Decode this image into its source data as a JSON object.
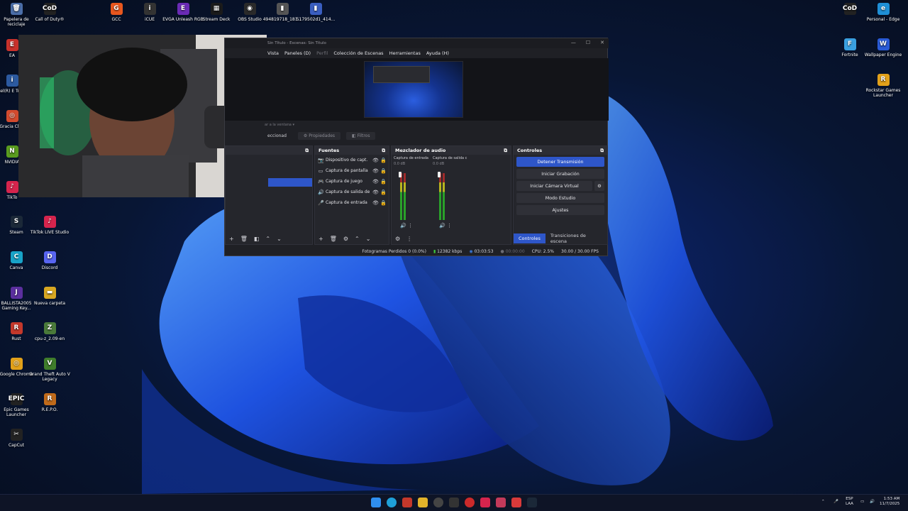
{
  "desktop_left": [
    {
      "label": "Papelera de reciclaje",
      "glyph": "🗑",
      "color": "#4b6ea8"
    },
    {
      "label": "Call of Duty®",
      "glyph": "CoD",
      "color": "#222"
    },
    {
      "label": "GCC",
      "glyph": "G",
      "color": "#e8571e"
    },
    {
      "label": "iCUE",
      "glyph": "i",
      "color": "#333"
    },
    {
      "label": "EVGA Unleash RGB",
      "glyph": "E",
      "color": "#6a2bb5"
    },
    {
      "label": "Stream Deck",
      "glyph": "▦",
      "color": "#1b1b1b"
    },
    {
      "label": "OBS Studio",
      "glyph": "◉",
      "color": "#2a2a2a"
    },
    {
      "label": "494819718_181...",
      "glyph": "▮",
      "color": "#555"
    },
    {
      "label": "5179502d1_414...",
      "glyph": "▮",
      "color": "#3a5ec0"
    }
  ],
  "desktop_col1": [
    {
      "label": "Steam",
      "glyph": "S",
      "color": "#1b2838"
    },
    {
      "label": "Canva",
      "glyph": "C",
      "color": "#18a3c8"
    },
    {
      "label": "BALLISTA2005 Gaming Key...",
      "glyph": "J",
      "color": "#5b2f9e"
    },
    {
      "label": "Rust",
      "glyph": "R",
      "color": "#c4382b"
    },
    {
      "label": "Google Chrome",
      "glyph": "◎",
      "color": "#e2a11a"
    },
    {
      "label": "Epic Games Launcher",
      "glyph": "EPIC",
      "color": "#222"
    },
    {
      "label": "CapCut",
      "glyph": "✂",
      "color": "#222"
    }
  ],
  "desktop_col1_partial": [
    {
      "label": "EA",
      "glyph": "E",
      "color": "#c8312b"
    },
    {
      "label": "Intel(R) E Tuning",
      "glyph": "i",
      "color": "#2c5aa0"
    },
    {
      "label": "Gracia Chro",
      "glyph": "◎",
      "color": "#d24a2e"
    },
    {
      "label": "NVIDIA",
      "glyph": "N",
      "color": "#5a9c1f"
    },
    {
      "label": "TikTo",
      "glyph": "♪",
      "color": "#d6244d"
    }
  ],
  "desktop_col2": [
    {
      "label": "TikTok LIVE Studio",
      "glyph": "♪",
      "color": "#d6244d"
    },
    {
      "label": "Discord",
      "glyph": "D",
      "color": "#5865f2"
    },
    {
      "label": "Nueva carpeta",
      "glyph": "▬",
      "color": "#d8a722"
    },
    {
      "label": "cpu-z_2.09-en",
      "glyph": "Z",
      "color": "#4a7a3a"
    },
    {
      "label": "Grand Theft Auto V Legacy",
      "glyph": "V",
      "color": "#3f7d2b"
    },
    {
      "label": "R.E.P.O.",
      "glyph": "R",
      "color": "#c06a1a"
    }
  ],
  "desktop_right": [
    {
      "label": "",
      "glyph": "CoD",
      "color": "#222"
    },
    {
      "label": "Personal - Edge",
      "glyph": "e",
      "color": "#1f8fd6"
    },
    {
      "label": "Fortnite",
      "glyph": "F",
      "color": "#3aa0e0"
    },
    {
      "label": "Wallpaper Engine",
      "glyph": "W",
      "color": "#2a5bd7"
    },
    {
      "label": "Rockstar Games Launcher",
      "glyph": "R",
      "color": "#e2a11a"
    }
  ],
  "obs": {
    "title": "Sin Título - Escenas: Sin Título",
    "menus": [
      "Vista",
      "Paneles (D)",
      "Perfil",
      "Colección de Escenas",
      "Herramientas",
      "Ayuda (H)"
    ],
    "preview_hint": "ar a la ventana",
    "tab_selected": "eccionad",
    "tab_props": "Propiedades",
    "tab_filters": "Filtros",
    "sources_title": "Fuentes",
    "sources": [
      "Dispositivo de capt.",
      "Captura de pantalla",
      "Captura de juego",
      "Captura de salida de",
      "Captura de entrada"
    ],
    "mixer_title": "Mezclador de audio",
    "mixer_channels": [
      {
        "name": "Captura de entrada",
        "db": "0.0 dB"
      },
      {
        "name": "Captura de salida c",
        "db": "0.0 dB"
      }
    ],
    "controls_title": "Controles",
    "controls_buttons": [
      "Detener Transmisión",
      "Iniciar Grabación",
      "Iniciar Cámara Virtual",
      "Modo Estudio",
      "Ajustes"
    ],
    "controls_tabs": [
      "Controles",
      "Transiciones de escena"
    ],
    "status": {
      "dropped": "Fotogramas Perdidos 0 (0.0%)",
      "kbps": "12382 kbps",
      "stream_time": "03:03:53",
      "rec_time": "00:00:00",
      "cpu": "CPU: 2.5%",
      "fps": "30.00 / 30.00 FPS"
    }
  },
  "tray": {
    "lang": "ESP",
    "lang2": "LAA",
    "time": "1:53 AM",
    "date": "11/7/2025"
  }
}
